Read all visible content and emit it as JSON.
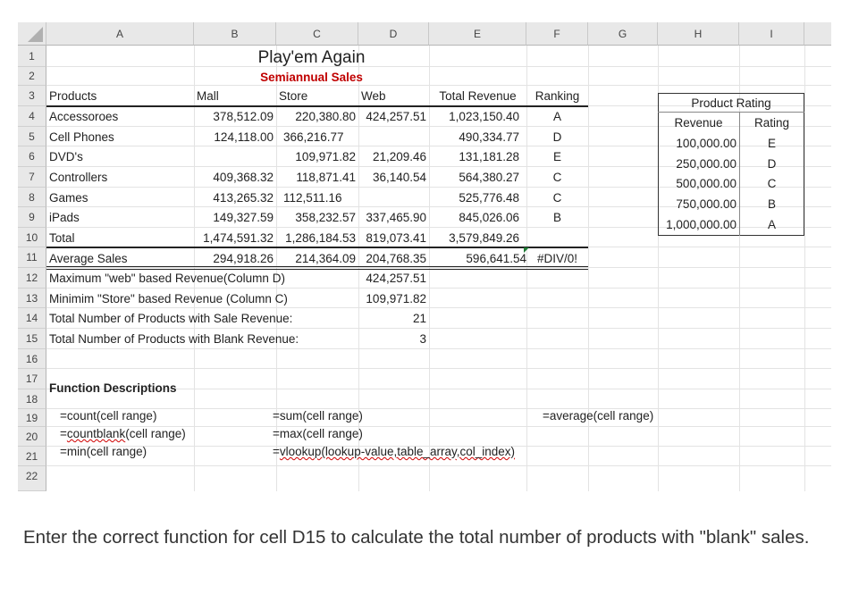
{
  "columns": [
    "A",
    "B",
    "C",
    "D",
    "E",
    "F",
    "G",
    "H",
    "I"
  ],
  "rows": [
    "1",
    "2",
    "3",
    "4",
    "5",
    "6",
    "7",
    "8",
    "9",
    "10",
    "11",
    "12",
    "13",
    "14",
    "15",
    "16",
    "17",
    "18",
    "19",
    "20",
    "21",
    "22"
  ],
  "title": "Play'em Again",
  "subtitle": "Semiannual Sales",
  "headers": {
    "products": "Products",
    "mall": "Mall",
    "store": "Store",
    "web": "Web",
    "total_revenue": "Total Revenue",
    "ranking": "Ranking"
  },
  "products": [
    {
      "name": "Accessoroes",
      "mall": "378,512.09",
      "store": "220,380.80",
      "web": "424,257.51",
      "total": "1,023,150.40",
      "rank": "A"
    },
    {
      "name": "Cell Phones",
      "mall": "124,118.00",
      "store": "366,216.77",
      "web": "",
      "total": "490,334.77",
      "rank": "D"
    },
    {
      "name": "DVD's",
      "mall": "",
      "store": "109,971.82",
      "web": "21,209.46",
      "total": "131,181.28",
      "rank": "E"
    },
    {
      "name": "Controllers",
      "mall": "409,368.32",
      "store": "118,871.41",
      "web": "36,140.54",
      "total": "564,380.27",
      "rank": "C"
    },
    {
      "name": "Games",
      "mall": "413,265.32",
      "store": "112,511.16",
      "web": "",
      "total": "525,776.48",
      "rank": "C"
    },
    {
      "name": "iPads",
      "mall": "149,327.59",
      "store": "358,232.57",
      "web": "337,465.90",
      "total": "845,026.06",
      "rank": "B"
    }
  ],
  "total_row": {
    "label": "Total",
    "mall": "1,474,591.32",
    "store": "1,286,184.53",
    "web": "819,073.41",
    "total": "3,579,849.26"
  },
  "average_row": {
    "label": "Average Sales",
    "mall": "294,918.26",
    "store": "214,364.09",
    "web": "204,768.35",
    "total": "596,641.54",
    "rank": "#DIV/0!"
  },
  "stats": [
    {
      "label": "Maximum \"web\" based Revenue(Column D)",
      "value": "424,257.51"
    },
    {
      "label": "Minimim \"Store\" based Revenue (Column C)",
      "value": "109,971.82"
    },
    {
      "label": "Total Number of Products with Sale Revenue:",
      "value": "21"
    },
    {
      "label": "Total Number of Products with Blank Revenue:",
      "value": "3"
    }
  ],
  "product_rating": {
    "title": "Product Rating",
    "col_revenue": "Revenue",
    "col_rating": "Rating",
    "rows": [
      {
        "revenue": "100,000.00",
        "rating": "E"
      },
      {
        "revenue": "250,000.00",
        "rating": "D"
      },
      {
        "revenue": "500,000.00",
        "rating": "C"
      },
      {
        "revenue": "750,000.00",
        "rating": "B"
      },
      {
        "revenue": "1,000,000.00",
        "rating": "A"
      }
    ]
  },
  "function_descriptions": {
    "title": "Function Descriptions",
    "count": "=count(cell range)",
    "countblank_prefix": "=",
    "countblank_word": "countblank",
    "countblank_suffix": "(cell range)",
    "min": "=min(cell range)",
    "sum": "=sum(cell range)",
    "max": "=max(cell range)",
    "vlookup_prefix": "=",
    "vlookup_word": "vlookup(lookup-value,table_array,col_index)",
    "average": "=average(cell range)"
  },
  "question": "Enter the correct function for cell D15 to calculate the total number of products with \"blank\" sales."
}
